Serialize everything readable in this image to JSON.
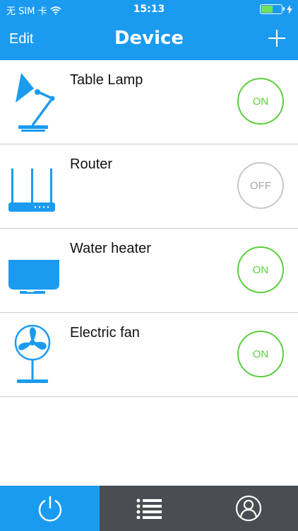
{
  "status_bar": {
    "carrier": "无 SIM 卡",
    "time": "15:13",
    "battery_level": 0.58,
    "icons": [
      "wifi-icon",
      "battery-icon",
      "charging-icon"
    ]
  },
  "nav": {
    "edit_label": "Edit",
    "title": "Device",
    "add_icon": "plus-icon"
  },
  "devices": [
    {
      "name": "Table Lamp",
      "icon": "table-lamp-icon",
      "state": "ON"
    },
    {
      "name": "Router",
      "icon": "router-icon",
      "state": "OFF"
    },
    {
      "name": "Water heater",
      "icon": "water-heater-icon",
      "state": "ON"
    },
    {
      "name": "Electric fan",
      "icon": "electric-fan-icon",
      "state": "ON"
    }
  ],
  "tabs": [
    {
      "icon": "power-icon",
      "active": true
    },
    {
      "icon": "list-icon",
      "active": false
    },
    {
      "icon": "user-icon",
      "active": false
    }
  ],
  "colors": {
    "accent": "#1a9bf0",
    "on": "#5ccf3f",
    "off": "#c9c9c9",
    "tabbar": "#4a4d51"
  }
}
